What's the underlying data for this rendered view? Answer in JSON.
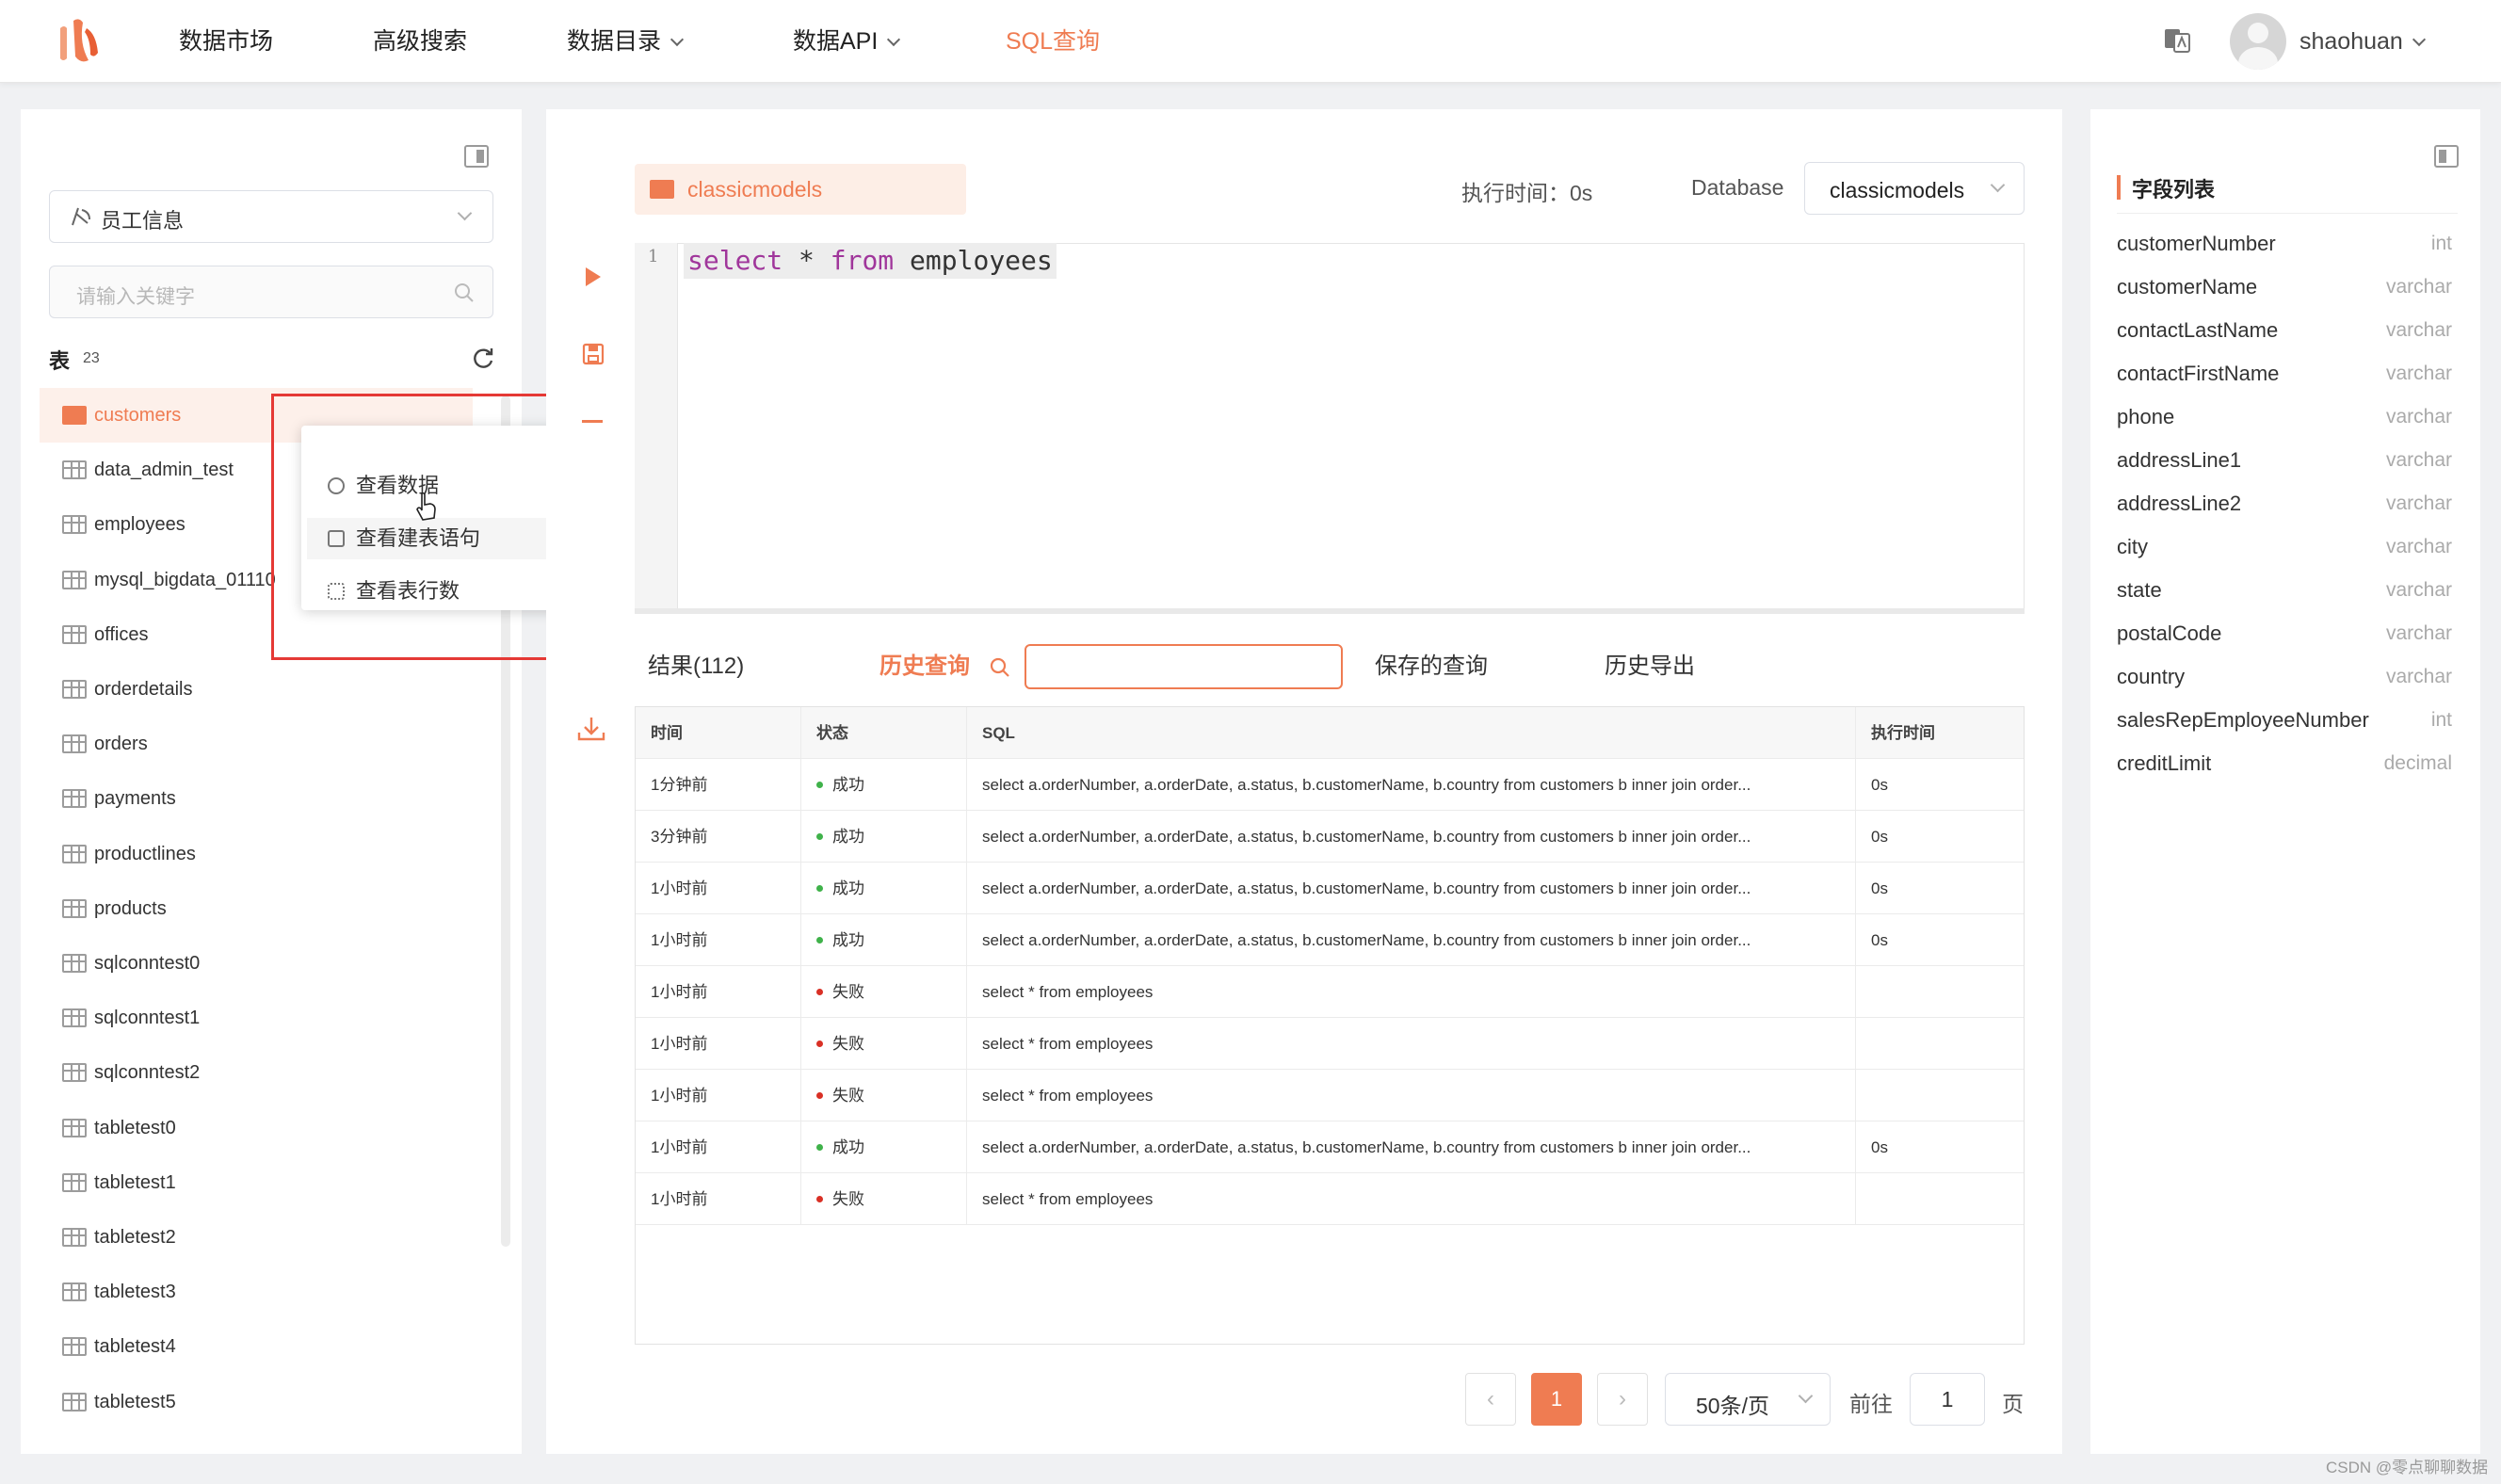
{
  "nav": {
    "items": [
      "数据市场",
      "高级搜索",
      "数据目录",
      "数据API",
      "SQL查询"
    ],
    "active": "SQL查询",
    "user": "shaohuan"
  },
  "left": {
    "db_select": "员工信息",
    "search_placeholder": "请输入关键字",
    "tables_label": "表",
    "tables_count": "23",
    "tables": [
      "customers",
      "data_admin_test",
      "employees",
      "mysql_bigdata_01110",
      "offices",
      "orderdetails",
      "orders",
      "payments",
      "productlines",
      "products",
      "sqlconntest0",
      "sqlconntest1",
      "sqlconntest2",
      "tabletest0",
      "tabletest1",
      "tabletest2",
      "tabletest3",
      "tabletest4",
      "tabletest5"
    ],
    "context_menu": [
      "查看数据",
      "查看建表语句",
      "查看表行数"
    ]
  },
  "editor": {
    "tab": "classicmodels",
    "exec_time": "执行时间：0s",
    "database_label": "Database",
    "database": "classicmodels",
    "line_no": "1",
    "code": {
      "kw1": "select",
      "star": " * ",
      "kw2": "from",
      "rest": " employees"
    }
  },
  "results": {
    "tabs": [
      "结果(112)",
      "历史查询",
      "保存的查询",
      "历史导出"
    ],
    "active_tab": "历史查询",
    "columns": [
      "时间",
      "状态",
      "SQL",
      "执行时间"
    ],
    "rows": [
      {
        "time": "1分钟前",
        "status": "成功",
        "ok": true,
        "sql": "select a.orderNumber, a.orderDate, a.status, b.customerName, b.country from customers b inner join order...",
        "dur": "0s"
      },
      {
        "time": "3分钟前",
        "status": "成功",
        "ok": true,
        "sql": "select a.orderNumber, a.orderDate, a.status, b.customerName, b.country from customers b inner join order...",
        "dur": "0s"
      },
      {
        "time": "1小时前",
        "status": "成功",
        "ok": true,
        "sql": "select a.orderNumber, a.orderDate, a.status, b.customerName, b.country from customers b inner join order...",
        "dur": "0s"
      },
      {
        "time": "1小时前",
        "status": "成功",
        "ok": true,
        "sql": "select a.orderNumber, a.orderDate, a.status, b.customerName, b.country from customers b inner join order...",
        "dur": "0s"
      },
      {
        "time": "1小时前",
        "status": "失败",
        "ok": false,
        "sql": "select * from employees",
        "dur": ""
      },
      {
        "time": "1小时前",
        "status": "失败",
        "ok": false,
        "sql": "select * from employees",
        "dur": ""
      },
      {
        "time": "1小时前",
        "status": "失败",
        "ok": false,
        "sql": "select * from employees",
        "dur": ""
      },
      {
        "time": "1小时前",
        "status": "成功",
        "ok": true,
        "sql": "select a.orderNumber, a.orderDate, a.status, b.customerName, b.country from customers b inner join order...",
        "dur": "0s"
      },
      {
        "time": "1小时前",
        "status": "失败",
        "ok": false,
        "sql": "select * from employees",
        "dur": ""
      }
    ],
    "pagination": {
      "prev": "‹",
      "page": "1",
      "next": "›",
      "size": "50条/页",
      "goto": "前往",
      "goto_value": "1",
      "page_suffix": "页"
    }
  },
  "fields": {
    "title": "字段列表",
    "items": [
      {
        "name": "customerNumber",
        "type": "int"
      },
      {
        "name": "customerName",
        "type": "varchar"
      },
      {
        "name": "contactLastName",
        "type": "varchar"
      },
      {
        "name": "contactFirstName",
        "type": "varchar"
      },
      {
        "name": "phone",
        "type": "varchar"
      },
      {
        "name": "addressLine1",
        "type": "varchar"
      },
      {
        "name": "addressLine2",
        "type": "varchar"
      },
      {
        "name": "city",
        "type": "varchar"
      },
      {
        "name": "state",
        "type": "varchar"
      },
      {
        "name": "postalCode",
        "type": "varchar"
      },
      {
        "name": "country",
        "type": "varchar"
      },
      {
        "name": "salesRepEmployeeNumber",
        "type": "int"
      },
      {
        "name": "creditLimit",
        "type": "decimal"
      }
    ]
  },
  "watermark": "CSDN @零点聊聊数据",
  "colors": {
    "accent": "#ef7c52",
    "success": "#3fb24a",
    "fail": "#d93025",
    "highlight": "#e53935"
  }
}
